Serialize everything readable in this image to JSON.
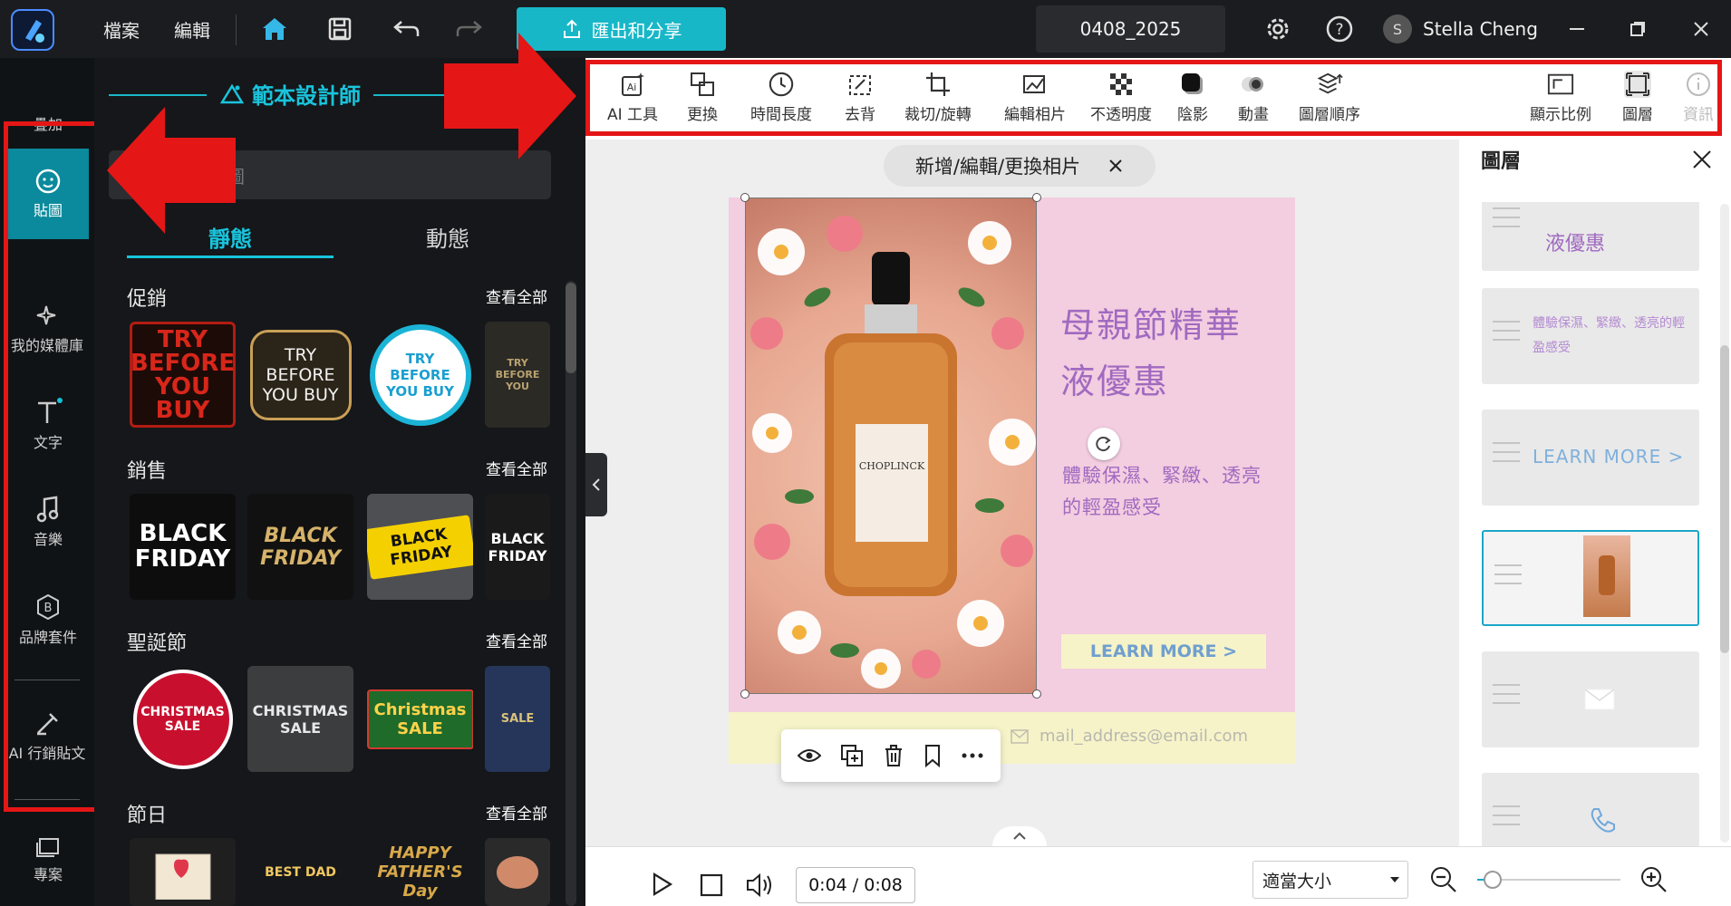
{
  "titlebar": {
    "menu_file": "檔案",
    "menu_edit": "編輯",
    "export_label": "匯出和分享",
    "project_name": "0408_2025",
    "avatar_letter": "S",
    "user_name": "Stella Cheng"
  },
  "left_rail": {
    "items": [
      {
        "label": "疊加",
        "icon": "overlay-icon"
      },
      {
        "label": "貼圖",
        "icon": "sticker-icon"
      },
      {
        "label": "我的媒體庫",
        "icon": "sparkle-media-icon"
      },
      {
        "label": "文字",
        "icon": "text-icon"
      },
      {
        "label": "音樂",
        "icon": "music-icon"
      },
      {
        "label": "品牌套件",
        "icon": "brand-icon"
      },
      {
        "label": "AI 行銷貼文",
        "icon": "ai-post-icon"
      },
      {
        "label": "專案",
        "icon": "project-icon"
      }
    ]
  },
  "sticker_panel": {
    "header": "範本設計師",
    "search_placeholder": "圖",
    "tab_static": "靜態",
    "tab_dynamic": "動態",
    "see_all": "查看全部",
    "sections": [
      {
        "title": "促銷",
        "stickers": [
          "TRY BEFORE YOU BUY",
          "TRY BEFORE YOU BUY",
          "TRY BEFORE YOU BUY",
          "TRY BEFORE YOU"
        ]
      },
      {
        "title": "銷售",
        "stickers": [
          "BLACK FRIDAY",
          "BLACK FRIDAY",
          "BLACK FRIDAY",
          "BLACK FRIDAY"
        ]
      },
      {
        "title": "聖誕節",
        "stickers": [
          "CHRISTMAS SALE",
          "CHRISTMAS SALE",
          "Christmas SALE",
          "SALE"
        ]
      },
      {
        "title": "節日",
        "stickers": [
          "",
          "BEST DAD",
          "HAPPY FATHER'S Day",
          ""
        ]
      }
    ]
  },
  "toolbar": {
    "tools": [
      "AI 工具",
      "更換",
      "時間長度",
      "去背",
      "裁切/旋轉",
      "編輯相片",
      "不透明度",
      "陰影",
      "動畫",
      "圖層順序"
    ],
    "right_tools": [
      "顯示比例",
      "圖層",
      "資訊"
    ]
  },
  "canvas": {
    "photo_tab_label": "新增/編輯/更換相片",
    "headline": "母親節精華液優惠",
    "subtext": "體驗保濕、緊緻、透亮的輕盈感受",
    "cta": "LEARN MORE >",
    "email": "mail_address@email.com",
    "bottle_label": "CHOPLINCK"
  },
  "bottom_bar": {
    "time": "0:04 / 0:08",
    "zoom_option": "適當大小"
  },
  "layers_panel": {
    "title": "圖層",
    "layer_text_1": "液優惠",
    "layer_text_2": "體驗保濕、緊緻、透亮的輕盈感受",
    "layer_text_3": "LEARN MORE >"
  },
  "colors": {
    "accent": "#17b7c8",
    "highlight_red": "#e51616",
    "canvas_pink": "#f3cde0",
    "canvas_yellow": "#f6f3c8",
    "headline_purple": "#a06ac0"
  }
}
